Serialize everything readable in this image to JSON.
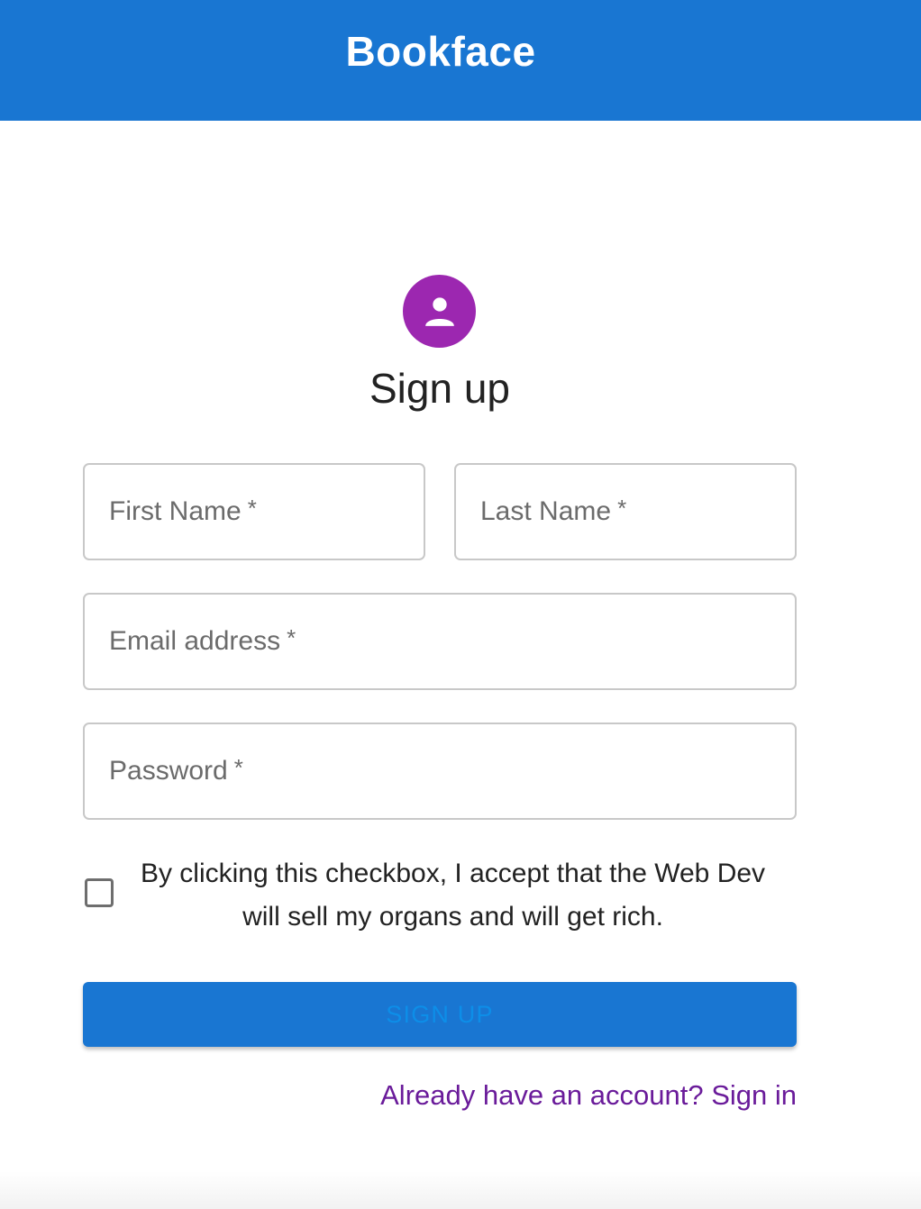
{
  "appbar": {
    "title": "Bookface"
  },
  "header": {
    "icon": "person-icon",
    "title": "Sign up"
  },
  "form": {
    "first_name": {
      "label": "First Name",
      "required_mark": "*"
    },
    "last_name": {
      "label": "Last Name",
      "required_mark": "*"
    },
    "email": {
      "label": "Email address",
      "required_mark": "*"
    },
    "password": {
      "label": "Password",
      "required_mark": "*"
    },
    "consent": {
      "checked": false,
      "text": "By clicking this checkbox, I accept that the Web Dev will sell my organs and will get rich."
    },
    "submit_label": "SIGN UP",
    "signin_link": "Already have an account? Sign in"
  },
  "colors": {
    "primary": "#1976d2",
    "avatar": "#9c27b0",
    "button_text": "#0d8ee8",
    "link": "#6a1b9a"
  }
}
